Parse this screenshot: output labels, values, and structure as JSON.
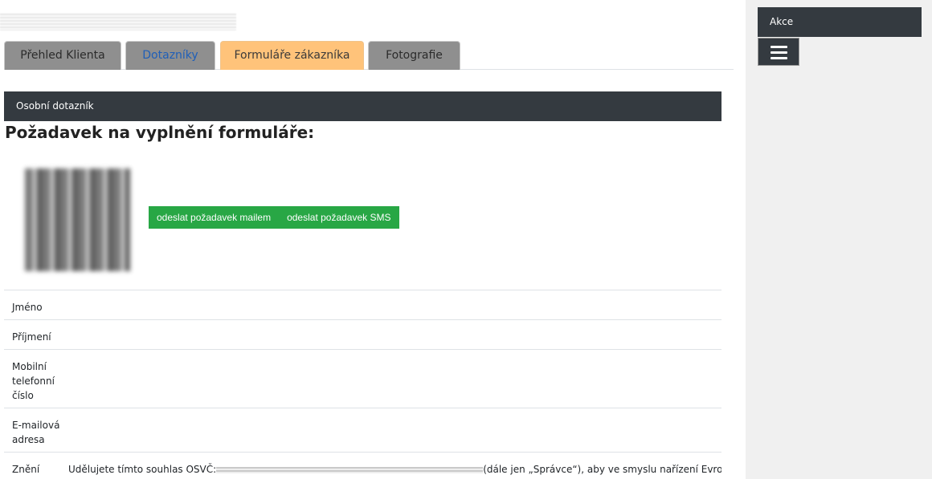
{
  "tabs": [
    {
      "label": "Přehled Klienta"
    },
    {
      "label": "Dotazníky"
    },
    {
      "label": "Formuláře zákazníka"
    },
    {
      "label": "Fotografie"
    }
  ],
  "section": {
    "title": "Osobní dotazník"
  },
  "heading": "Požadavek na vyplnění formuláře:",
  "buttons": {
    "mail": "odeslat požadavek mailem",
    "sms": "odeslat požadavek SMS"
  },
  "rows": [
    {
      "label": "Jméno",
      "value": ""
    },
    {
      "label": "Příjmení",
      "value": ""
    },
    {
      "label": "Mobilní telefonní číslo",
      "value": ""
    },
    {
      "label": "E-mailová adresa",
      "value": ""
    },
    {
      "label": "Znění",
      "value_prefix": "Udělujete tímto souhlas OSVČ:",
      "value_suffix": "(dále jen „Správce“), aby ve smyslu nařízení Evropského"
    }
  ],
  "sidebar": {
    "akce": "Akce"
  },
  "colors": {
    "dark": "#343a40",
    "green": "#28a745",
    "active_tab": "#ffc37a"
  }
}
